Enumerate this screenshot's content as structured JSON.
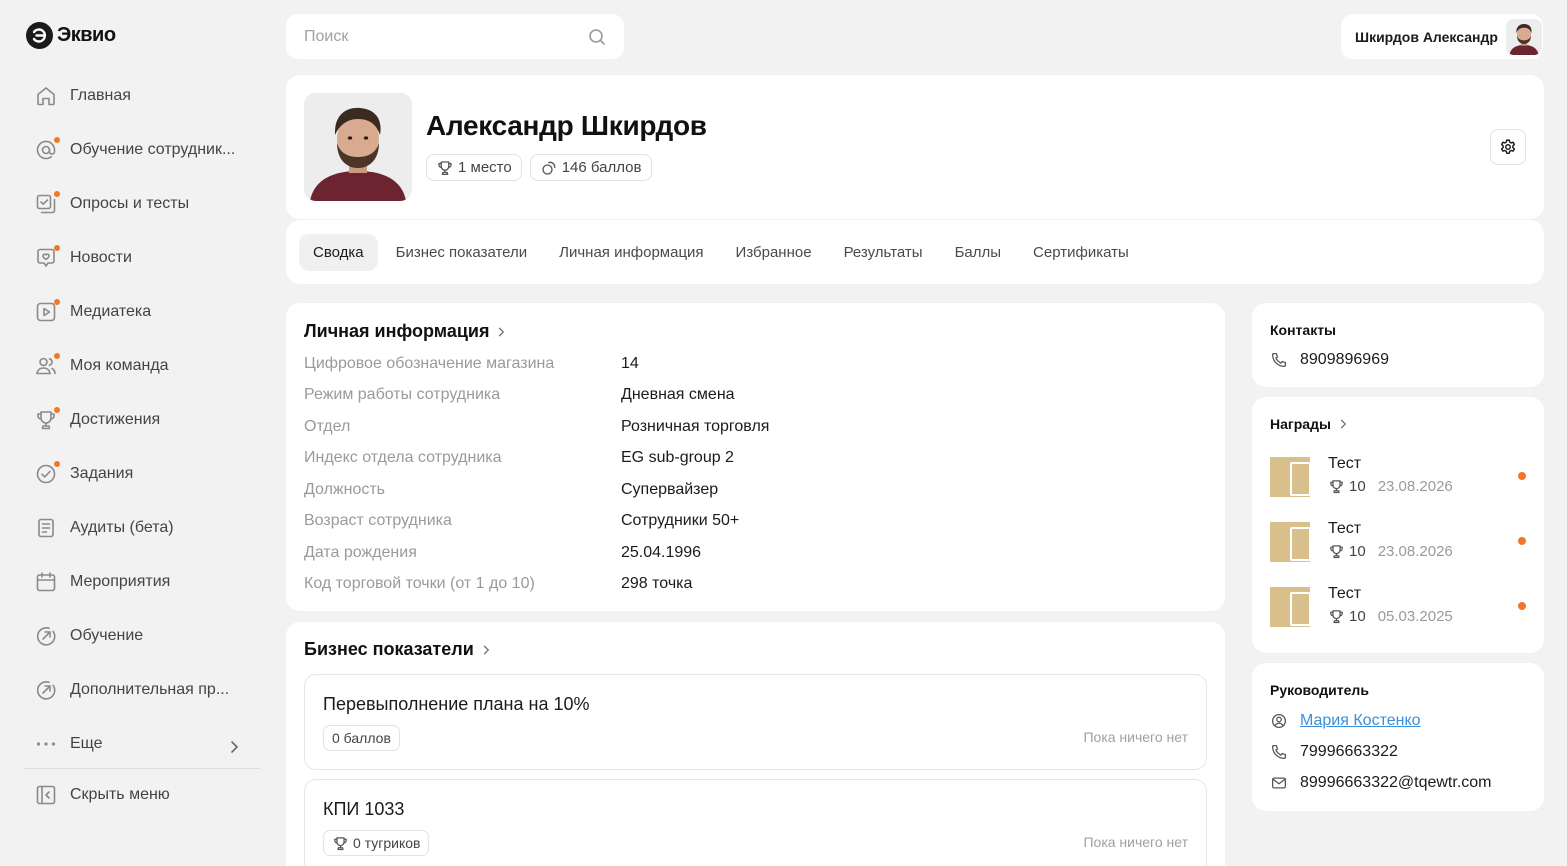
{
  "app": {
    "logo_text": "Эквио",
    "logo_icon": "eqvio-logo-icon",
    "accent_color": "#f2772a",
    "link_color": "#3b8fd9"
  },
  "sidebar": {
    "items": [
      {
        "label": "Главная",
        "icon": "home-icon",
        "has_dot": false
      },
      {
        "label": "Обучение сотрудник...",
        "icon": "at-icon",
        "has_dot": true
      },
      {
        "label": "Опросы и тесты",
        "icon": "survey-icon",
        "has_dot": true
      },
      {
        "label": "Новости",
        "icon": "news-heart-icon",
        "has_dot": true
      },
      {
        "label": "Медиатека",
        "icon": "play-icon",
        "has_dot": true
      },
      {
        "label": "Моя команда",
        "icon": "team-icon",
        "has_dot": true
      },
      {
        "label": "Достижения",
        "icon": "trophy-icon",
        "has_dot": true
      },
      {
        "label": "Задания",
        "icon": "check-circle-icon",
        "has_dot": true
      },
      {
        "label": "Аудиты (бета)",
        "icon": "audit-document-icon",
        "has_dot": false
      },
      {
        "label": "Мероприятия",
        "icon": "calendar-icon",
        "has_dot": false
      },
      {
        "label": "Обучение",
        "icon": "arrow-circle-icon",
        "has_dot": false
      },
      {
        "label": "Дополнительная пр...",
        "icon": "arrow-circle-icon",
        "has_dot": false
      },
      {
        "label": "Еще",
        "icon": "more-dots-icon",
        "has_dot": false
      }
    ],
    "hide_menu_label": "Скрыть меню"
  },
  "search": {
    "placeholder": "Поиск",
    "value": ""
  },
  "user": {
    "name": "Шкирдов Александр"
  },
  "profile": {
    "full_name": "Александр Шкирдов",
    "rank": "1 место",
    "points": "146 баллов"
  },
  "tabs": [
    {
      "label": "Сводка",
      "active": true
    },
    {
      "label": "Бизнес показатели",
      "active": false
    },
    {
      "label": "Личная информация",
      "active": false
    },
    {
      "label": "Избранное",
      "active": false
    },
    {
      "label": "Результаты",
      "active": false
    },
    {
      "label": "Баллы",
      "active": false
    },
    {
      "label": "Сертификаты",
      "active": false
    }
  ],
  "personal_info": {
    "title": "Личная информация",
    "rows": [
      {
        "key": "Цифровое обозначение магазина",
        "value": "14"
      },
      {
        "key": "Режим работы сотрудника",
        "value": "Дневная смена"
      },
      {
        "key": "Отдел",
        "value": "Розничная торговля"
      },
      {
        "key": "Индекс отдела сотрудника",
        "value": "EG sub-group 2"
      },
      {
        "key": "Должность",
        "value": "Супервайзер"
      },
      {
        "key": "Возраст сотрудника",
        "value": "Сотрудники 50+"
      },
      {
        "key": "Дата рождения",
        "value": "25.04.1996"
      },
      {
        "key": "Код торговой точки (от 1 до 10)",
        "value": "298 точка"
      }
    ]
  },
  "business": {
    "title": "Бизнес показатели",
    "items": [
      {
        "title": "Перевыполнение плана на 10%",
        "badge": "0 баллов",
        "has_trophy": false,
        "empty_text": "Пока ничего нет"
      },
      {
        "title": "КПИ 1033",
        "badge": "0 тугриков",
        "has_trophy": true,
        "empty_text": "Пока ничего нет"
      }
    ]
  },
  "contacts": {
    "title": "Контакты",
    "phone": "8909896969"
  },
  "awards": {
    "title": "Награды",
    "items": [
      {
        "name": "Тест",
        "points": "10",
        "date": "23.08.2026"
      },
      {
        "name": "Тест",
        "points": "10",
        "date": "23.08.2026"
      },
      {
        "name": "Тест",
        "points": "10",
        "date": "05.03.2025"
      }
    ]
  },
  "manager": {
    "title": "Руководитель",
    "name": "Мария Костенко",
    "phone": "79996663322",
    "email": "89996663322@tqewtr.com"
  }
}
